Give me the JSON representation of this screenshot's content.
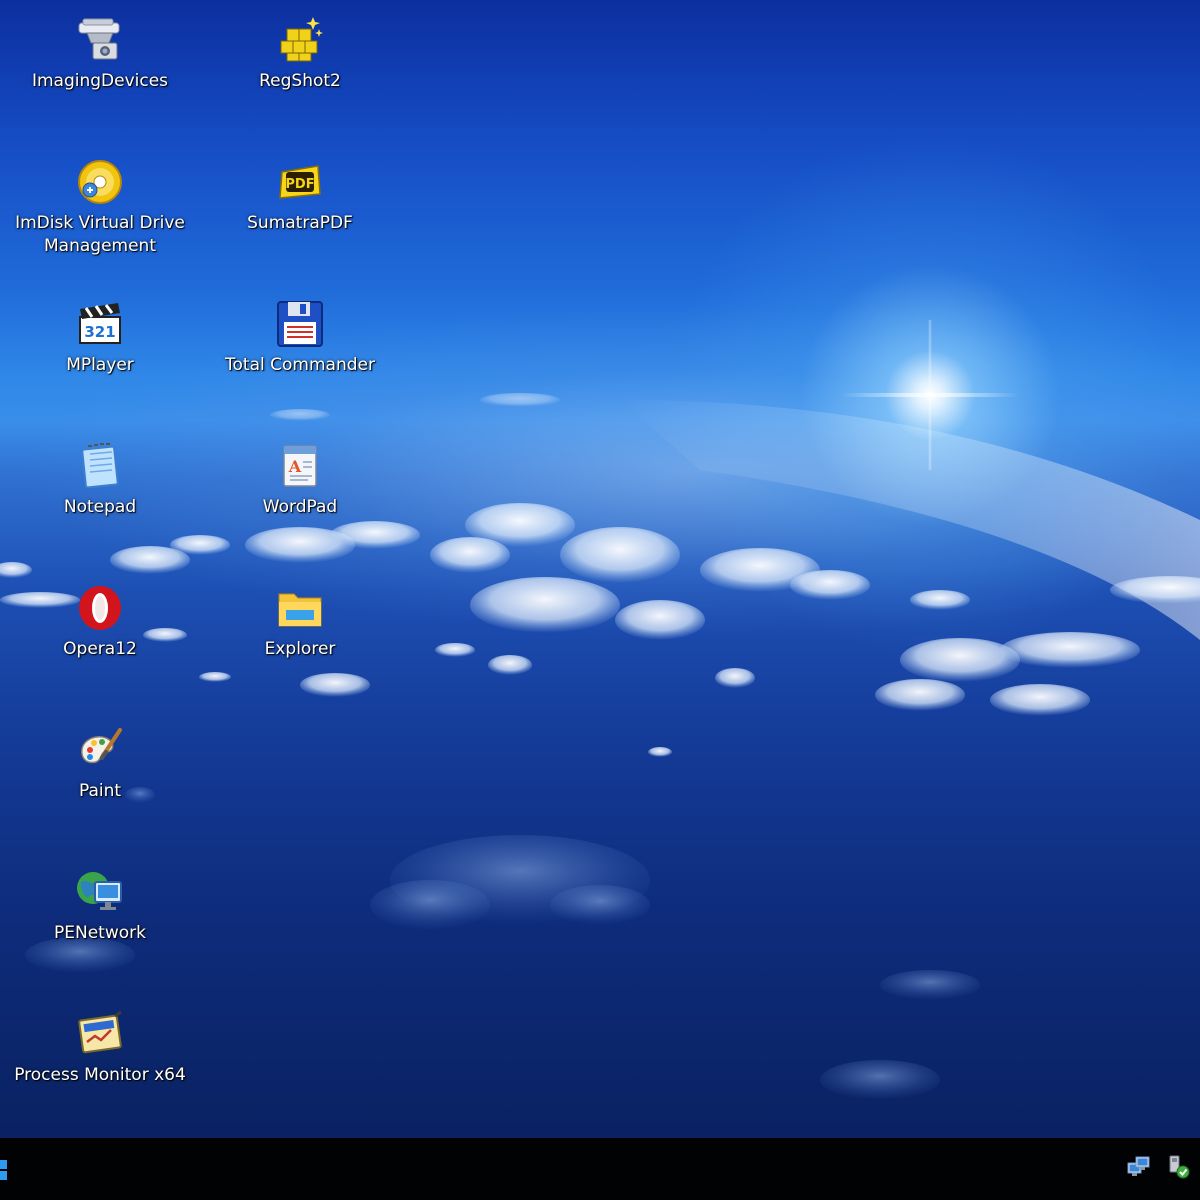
{
  "desktop": {
    "icons": [
      {
        "label": "ImagingDevices",
        "icon": "imaging-devices-icon"
      },
      {
        "label": "RegShot2",
        "icon": "regshot-icon"
      },
      {
        "label": "ImDisk Virtual Drive Management",
        "icon": "imdisk-disc-icon"
      },
      {
        "label": "SumatraPDF",
        "icon": "sumatra-pdf-icon"
      },
      {
        "label": "MPlayer",
        "icon": "mplayer-clapper-icon"
      },
      {
        "label": "Total Commander",
        "icon": "total-commander-floppy-icon"
      },
      {
        "label": "Notepad",
        "icon": "notepad-icon"
      },
      {
        "label": "WordPad",
        "icon": "wordpad-icon"
      },
      {
        "label": "Opera12",
        "icon": "opera-icon"
      },
      {
        "label": "Explorer",
        "icon": "folder-explorer-icon"
      },
      {
        "label": "Paint",
        "icon": "paint-palette-icon"
      },
      {
        "label": "PENetwork",
        "icon": "network-globe-icon"
      },
      {
        "label": "Process Monitor x64",
        "icon": "process-monitor-icon"
      }
    ]
  },
  "taskbar": {
    "start_icon": "start-windows-icon",
    "tray": [
      {
        "icon": "network-monitors-icon"
      },
      {
        "icon": "usb-safely-remove-icon"
      }
    ]
  },
  "colors": {
    "sky_top": "#0c2f9e",
    "horizon": "#3a8eea",
    "taskbar": "#010204"
  }
}
